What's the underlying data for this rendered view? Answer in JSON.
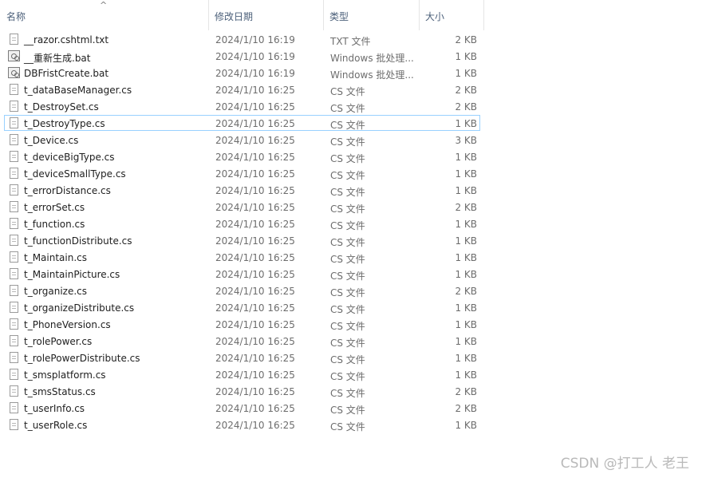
{
  "columns": {
    "name": "名称",
    "date": "修改日期",
    "type": "类型",
    "size": "大小"
  },
  "sort_icon": "^",
  "watermark": "CSDN @打工人 老王",
  "files": [
    {
      "name": "__razor.cshtml.txt",
      "date": "2024/1/10 16:19",
      "type": "TXT 文件",
      "size": "2 KB",
      "icon": "text-file-icon"
    },
    {
      "name": "__重新生成.bat",
      "date": "2024/1/10 16:19",
      "type": "Windows 批处理...",
      "size": "1 KB",
      "icon": "batch-file-icon"
    },
    {
      "name": "DBFristCreate.bat",
      "date": "2024/1/10 16:19",
      "type": "Windows 批处理...",
      "size": "1 KB",
      "icon": "batch-file-icon"
    },
    {
      "name": "t_dataBaseManager.cs",
      "date": "2024/1/10 16:25",
      "type": "CS 文件",
      "size": "2 KB",
      "icon": "cs-file-icon"
    },
    {
      "name": "t_DestroySet.cs",
      "date": "2024/1/10 16:25",
      "type": "CS 文件",
      "size": "2 KB",
      "icon": "cs-file-icon"
    },
    {
      "name": "t_DestroyType.cs",
      "date": "2024/1/10 16:25",
      "type": "CS 文件",
      "size": "1 KB",
      "icon": "cs-file-icon",
      "selected": true
    },
    {
      "name": "t_Device.cs",
      "date": "2024/1/10 16:25",
      "type": "CS 文件",
      "size": "3 KB",
      "icon": "cs-file-icon"
    },
    {
      "name": "t_deviceBigType.cs",
      "date": "2024/1/10 16:25",
      "type": "CS 文件",
      "size": "1 KB",
      "icon": "cs-file-icon"
    },
    {
      "name": "t_deviceSmallType.cs",
      "date": "2024/1/10 16:25",
      "type": "CS 文件",
      "size": "1 KB",
      "icon": "cs-file-icon"
    },
    {
      "name": "t_errorDistance.cs",
      "date": "2024/1/10 16:25",
      "type": "CS 文件",
      "size": "1 KB",
      "icon": "cs-file-icon"
    },
    {
      "name": "t_errorSet.cs",
      "date": "2024/1/10 16:25",
      "type": "CS 文件",
      "size": "2 KB",
      "icon": "cs-file-icon"
    },
    {
      "name": "t_function.cs",
      "date": "2024/1/10 16:25",
      "type": "CS 文件",
      "size": "1 KB",
      "icon": "cs-file-icon"
    },
    {
      "name": "t_functionDistribute.cs",
      "date": "2024/1/10 16:25",
      "type": "CS 文件",
      "size": "1 KB",
      "icon": "cs-file-icon"
    },
    {
      "name": "t_Maintain.cs",
      "date": "2024/1/10 16:25",
      "type": "CS 文件",
      "size": "1 KB",
      "icon": "cs-file-icon"
    },
    {
      "name": "t_MaintainPicture.cs",
      "date": "2024/1/10 16:25",
      "type": "CS 文件",
      "size": "1 KB",
      "icon": "cs-file-icon"
    },
    {
      "name": "t_organize.cs",
      "date": "2024/1/10 16:25",
      "type": "CS 文件",
      "size": "2 KB",
      "icon": "cs-file-icon"
    },
    {
      "name": "t_organizeDistribute.cs",
      "date": "2024/1/10 16:25",
      "type": "CS 文件",
      "size": "1 KB",
      "icon": "cs-file-icon"
    },
    {
      "name": "t_PhoneVersion.cs",
      "date": "2024/1/10 16:25",
      "type": "CS 文件",
      "size": "1 KB",
      "icon": "cs-file-icon"
    },
    {
      "name": "t_rolePower.cs",
      "date": "2024/1/10 16:25",
      "type": "CS 文件",
      "size": "1 KB",
      "icon": "cs-file-icon"
    },
    {
      "name": "t_rolePowerDistribute.cs",
      "date": "2024/1/10 16:25",
      "type": "CS 文件",
      "size": "1 KB",
      "icon": "cs-file-icon"
    },
    {
      "name": "t_smsplatform.cs",
      "date": "2024/1/10 16:25",
      "type": "CS 文件",
      "size": "1 KB",
      "icon": "cs-file-icon"
    },
    {
      "name": "t_smsStatus.cs",
      "date": "2024/1/10 16:25",
      "type": "CS 文件",
      "size": "2 KB",
      "icon": "cs-file-icon"
    },
    {
      "name": "t_userInfo.cs",
      "date": "2024/1/10 16:25",
      "type": "CS 文件",
      "size": "2 KB",
      "icon": "cs-file-icon"
    },
    {
      "name": "t_userRole.cs",
      "date": "2024/1/10 16:25",
      "type": "CS 文件",
      "size": "1 KB",
      "icon": "cs-file-icon"
    }
  ]
}
